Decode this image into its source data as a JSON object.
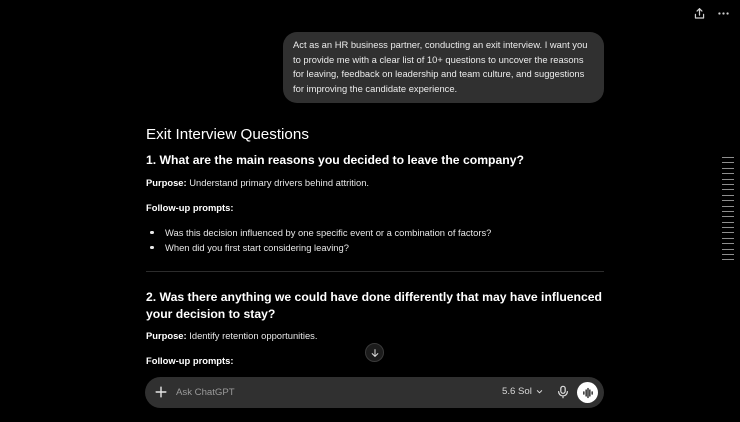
{
  "topbar": {
    "share_icon": "share-icon",
    "more_icon": "more-icon"
  },
  "user_message": "Act as an HR business partner, conducting an exit interview. I want you to provide me with a clear list of 10+ questions to uncover the reasons for leaving, feedback on leadership and team culture, and suggestions for improving the candidate experience.",
  "response": {
    "title": "Exit Interview Questions",
    "q1": {
      "heading": "1. What are the main reasons you decided to leave the company?",
      "purpose_label": "Purpose:",
      "purpose_text": " Understand primary drivers behind attrition.",
      "followup_label": "Follow-up prompts:",
      "bullets": [
        "Was this decision influenced by one specific event or a combination of factors?",
        "When did you first start considering leaving?"
      ]
    },
    "q2": {
      "heading": "2. Was there anything we could have done differently that may have influenced your decision to stay?",
      "purpose_label": "Purpose:",
      "purpose_text": " Identify retention opportunities.",
      "followup_label": "Follow-up prompts:"
    }
  },
  "composer": {
    "placeholder": "Ask ChatGPT",
    "model_label": "5.6 Sol",
    "plus_icon": "plus-icon",
    "mic_icon": "mic-icon",
    "voice_icon": "voice-mode-icon"
  },
  "scroll_down_icon": "arrow-down-icon"
}
